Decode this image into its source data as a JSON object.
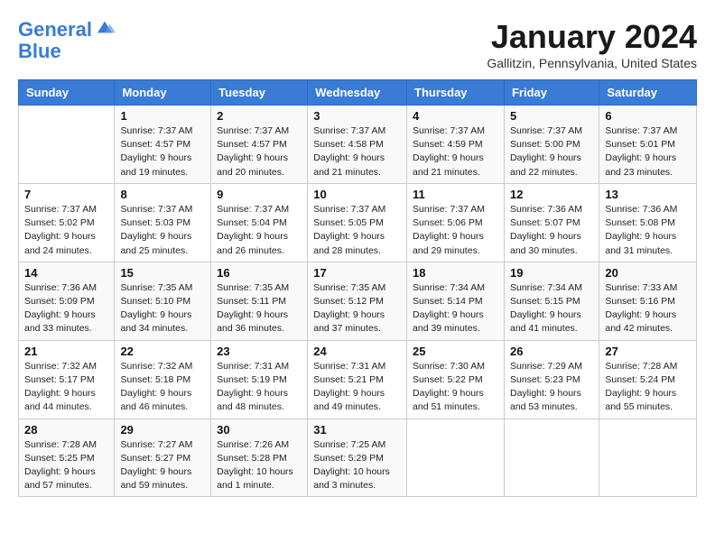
{
  "header": {
    "logo_line1": "General",
    "logo_line2": "Blue",
    "month_title": "January 2024",
    "location": "Gallitzin, Pennsylvania, United States"
  },
  "weekdays": [
    "Sunday",
    "Monday",
    "Tuesday",
    "Wednesday",
    "Thursday",
    "Friday",
    "Saturday"
  ],
  "weeks": [
    [
      {
        "day": "",
        "info": ""
      },
      {
        "day": "1",
        "info": "Sunrise: 7:37 AM\nSunset: 4:57 PM\nDaylight: 9 hours\nand 19 minutes."
      },
      {
        "day": "2",
        "info": "Sunrise: 7:37 AM\nSunset: 4:57 PM\nDaylight: 9 hours\nand 20 minutes."
      },
      {
        "day": "3",
        "info": "Sunrise: 7:37 AM\nSunset: 4:58 PM\nDaylight: 9 hours\nand 21 minutes."
      },
      {
        "day": "4",
        "info": "Sunrise: 7:37 AM\nSunset: 4:59 PM\nDaylight: 9 hours\nand 21 minutes."
      },
      {
        "day": "5",
        "info": "Sunrise: 7:37 AM\nSunset: 5:00 PM\nDaylight: 9 hours\nand 22 minutes."
      },
      {
        "day": "6",
        "info": "Sunrise: 7:37 AM\nSunset: 5:01 PM\nDaylight: 9 hours\nand 23 minutes."
      }
    ],
    [
      {
        "day": "7",
        "info": "Sunrise: 7:37 AM\nSunset: 5:02 PM\nDaylight: 9 hours\nand 24 minutes."
      },
      {
        "day": "8",
        "info": "Sunrise: 7:37 AM\nSunset: 5:03 PM\nDaylight: 9 hours\nand 25 minutes."
      },
      {
        "day": "9",
        "info": "Sunrise: 7:37 AM\nSunset: 5:04 PM\nDaylight: 9 hours\nand 26 minutes."
      },
      {
        "day": "10",
        "info": "Sunrise: 7:37 AM\nSunset: 5:05 PM\nDaylight: 9 hours\nand 28 minutes."
      },
      {
        "day": "11",
        "info": "Sunrise: 7:37 AM\nSunset: 5:06 PM\nDaylight: 9 hours\nand 29 minutes."
      },
      {
        "day": "12",
        "info": "Sunrise: 7:36 AM\nSunset: 5:07 PM\nDaylight: 9 hours\nand 30 minutes."
      },
      {
        "day": "13",
        "info": "Sunrise: 7:36 AM\nSunset: 5:08 PM\nDaylight: 9 hours\nand 31 minutes."
      }
    ],
    [
      {
        "day": "14",
        "info": "Sunrise: 7:36 AM\nSunset: 5:09 PM\nDaylight: 9 hours\nand 33 minutes."
      },
      {
        "day": "15",
        "info": "Sunrise: 7:35 AM\nSunset: 5:10 PM\nDaylight: 9 hours\nand 34 minutes."
      },
      {
        "day": "16",
        "info": "Sunrise: 7:35 AM\nSunset: 5:11 PM\nDaylight: 9 hours\nand 36 minutes."
      },
      {
        "day": "17",
        "info": "Sunrise: 7:35 AM\nSunset: 5:12 PM\nDaylight: 9 hours\nand 37 minutes."
      },
      {
        "day": "18",
        "info": "Sunrise: 7:34 AM\nSunset: 5:14 PM\nDaylight: 9 hours\nand 39 minutes."
      },
      {
        "day": "19",
        "info": "Sunrise: 7:34 AM\nSunset: 5:15 PM\nDaylight: 9 hours\nand 41 minutes."
      },
      {
        "day": "20",
        "info": "Sunrise: 7:33 AM\nSunset: 5:16 PM\nDaylight: 9 hours\nand 42 minutes."
      }
    ],
    [
      {
        "day": "21",
        "info": "Sunrise: 7:32 AM\nSunset: 5:17 PM\nDaylight: 9 hours\nand 44 minutes."
      },
      {
        "day": "22",
        "info": "Sunrise: 7:32 AM\nSunset: 5:18 PM\nDaylight: 9 hours\nand 46 minutes."
      },
      {
        "day": "23",
        "info": "Sunrise: 7:31 AM\nSunset: 5:19 PM\nDaylight: 9 hours\nand 48 minutes."
      },
      {
        "day": "24",
        "info": "Sunrise: 7:31 AM\nSunset: 5:21 PM\nDaylight: 9 hours\nand 49 minutes."
      },
      {
        "day": "25",
        "info": "Sunrise: 7:30 AM\nSunset: 5:22 PM\nDaylight: 9 hours\nand 51 minutes."
      },
      {
        "day": "26",
        "info": "Sunrise: 7:29 AM\nSunset: 5:23 PM\nDaylight: 9 hours\nand 53 minutes."
      },
      {
        "day": "27",
        "info": "Sunrise: 7:28 AM\nSunset: 5:24 PM\nDaylight: 9 hours\nand 55 minutes."
      }
    ],
    [
      {
        "day": "28",
        "info": "Sunrise: 7:28 AM\nSunset: 5:25 PM\nDaylight: 9 hours\nand 57 minutes."
      },
      {
        "day": "29",
        "info": "Sunrise: 7:27 AM\nSunset: 5:27 PM\nDaylight: 9 hours\nand 59 minutes."
      },
      {
        "day": "30",
        "info": "Sunrise: 7:26 AM\nSunset: 5:28 PM\nDaylight: 10 hours\nand 1 minute."
      },
      {
        "day": "31",
        "info": "Sunrise: 7:25 AM\nSunset: 5:29 PM\nDaylight: 10 hours\nand 3 minutes."
      },
      {
        "day": "",
        "info": ""
      },
      {
        "day": "",
        "info": ""
      },
      {
        "day": "",
        "info": ""
      }
    ]
  ]
}
